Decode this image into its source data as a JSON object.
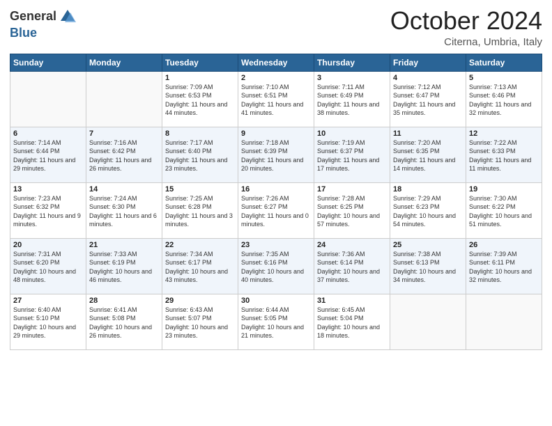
{
  "header": {
    "logo_general": "General",
    "logo_blue": "Blue",
    "month": "October 2024",
    "location": "Citerna, Umbria, Italy"
  },
  "weekdays": [
    "Sunday",
    "Monday",
    "Tuesday",
    "Wednesday",
    "Thursday",
    "Friday",
    "Saturday"
  ],
  "weeks": [
    [
      {
        "day": "",
        "sunrise": "",
        "sunset": "",
        "daylight": ""
      },
      {
        "day": "",
        "sunrise": "",
        "sunset": "",
        "daylight": ""
      },
      {
        "day": "1",
        "sunrise": "Sunrise: 7:09 AM",
        "sunset": "Sunset: 6:53 PM",
        "daylight": "Daylight: 11 hours and 44 minutes."
      },
      {
        "day": "2",
        "sunrise": "Sunrise: 7:10 AM",
        "sunset": "Sunset: 6:51 PM",
        "daylight": "Daylight: 11 hours and 41 minutes."
      },
      {
        "day": "3",
        "sunrise": "Sunrise: 7:11 AM",
        "sunset": "Sunset: 6:49 PM",
        "daylight": "Daylight: 11 hours and 38 minutes."
      },
      {
        "day": "4",
        "sunrise": "Sunrise: 7:12 AM",
        "sunset": "Sunset: 6:47 PM",
        "daylight": "Daylight: 11 hours and 35 minutes."
      },
      {
        "day": "5",
        "sunrise": "Sunrise: 7:13 AM",
        "sunset": "Sunset: 6:46 PM",
        "daylight": "Daylight: 11 hours and 32 minutes."
      }
    ],
    [
      {
        "day": "6",
        "sunrise": "Sunrise: 7:14 AM",
        "sunset": "Sunset: 6:44 PM",
        "daylight": "Daylight: 11 hours and 29 minutes."
      },
      {
        "day": "7",
        "sunrise": "Sunrise: 7:16 AM",
        "sunset": "Sunset: 6:42 PM",
        "daylight": "Daylight: 11 hours and 26 minutes."
      },
      {
        "day": "8",
        "sunrise": "Sunrise: 7:17 AM",
        "sunset": "Sunset: 6:40 PM",
        "daylight": "Daylight: 11 hours and 23 minutes."
      },
      {
        "day": "9",
        "sunrise": "Sunrise: 7:18 AM",
        "sunset": "Sunset: 6:39 PM",
        "daylight": "Daylight: 11 hours and 20 minutes."
      },
      {
        "day": "10",
        "sunrise": "Sunrise: 7:19 AM",
        "sunset": "Sunset: 6:37 PM",
        "daylight": "Daylight: 11 hours and 17 minutes."
      },
      {
        "day": "11",
        "sunrise": "Sunrise: 7:20 AM",
        "sunset": "Sunset: 6:35 PM",
        "daylight": "Daylight: 11 hours and 14 minutes."
      },
      {
        "day": "12",
        "sunrise": "Sunrise: 7:22 AM",
        "sunset": "Sunset: 6:33 PM",
        "daylight": "Daylight: 11 hours and 11 minutes."
      }
    ],
    [
      {
        "day": "13",
        "sunrise": "Sunrise: 7:23 AM",
        "sunset": "Sunset: 6:32 PM",
        "daylight": "Daylight: 11 hours and 9 minutes."
      },
      {
        "day": "14",
        "sunrise": "Sunrise: 7:24 AM",
        "sunset": "Sunset: 6:30 PM",
        "daylight": "Daylight: 11 hours and 6 minutes."
      },
      {
        "day": "15",
        "sunrise": "Sunrise: 7:25 AM",
        "sunset": "Sunset: 6:28 PM",
        "daylight": "Daylight: 11 hours and 3 minutes."
      },
      {
        "day": "16",
        "sunrise": "Sunrise: 7:26 AM",
        "sunset": "Sunset: 6:27 PM",
        "daylight": "Daylight: 11 hours and 0 minutes."
      },
      {
        "day": "17",
        "sunrise": "Sunrise: 7:28 AM",
        "sunset": "Sunset: 6:25 PM",
        "daylight": "Daylight: 10 hours and 57 minutes."
      },
      {
        "day": "18",
        "sunrise": "Sunrise: 7:29 AM",
        "sunset": "Sunset: 6:23 PM",
        "daylight": "Daylight: 10 hours and 54 minutes."
      },
      {
        "day": "19",
        "sunrise": "Sunrise: 7:30 AM",
        "sunset": "Sunset: 6:22 PM",
        "daylight": "Daylight: 10 hours and 51 minutes."
      }
    ],
    [
      {
        "day": "20",
        "sunrise": "Sunrise: 7:31 AM",
        "sunset": "Sunset: 6:20 PM",
        "daylight": "Daylight: 10 hours and 48 minutes."
      },
      {
        "day": "21",
        "sunrise": "Sunrise: 7:33 AM",
        "sunset": "Sunset: 6:19 PM",
        "daylight": "Daylight: 10 hours and 46 minutes."
      },
      {
        "day": "22",
        "sunrise": "Sunrise: 7:34 AM",
        "sunset": "Sunset: 6:17 PM",
        "daylight": "Daylight: 10 hours and 43 minutes."
      },
      {
        "day": "23",
        "sunrise": "Sunrise: 7:35 AM",
        "sunset": "Sunset: 6:16 PM",
        "daylight": "Daylight: 10 hours and 40 minutes."
      },
      {
        "day": "24",
        "sunrise": "Sunrise: 7:36 AM",
        "sunset": "Sunset: 6:14 PM",
        "daylight": "Daylight: 10 hours and 37 minutes."
      },
      {
        "day": "25",
        "sunrise": "Sunrise: 7:38 AM",
        "sunset": "Sunset: 6:13 PM",
        "daylight": "Daylight: 10 hours and 34 minutes."
      },
      {
        "day": "26",
        "sunrise": "Sunrise: 7:39 AM",
        "sunset": "Sunset: 6:11 PM",
        "daylight": "Daylight: 10 hours and 32 minutes."
      }
    ],
    [
      {
        "day": "27",
        "sunrise": "Sunrise: 6:40 AM",
        "sunset": "Sunset: 5:10 PM",
        "daylight": "Daylight: 10 hours and 29 minutes."
      },
      {
        "day": "28",
        "sunrise": "Sunrise: 6:41 AM",
        "sunset": "Sunset: 5:08 PM",
        "daylight": "Daylight: 10 hours and 26 minutes."
      },
      {
        "day": "29",
        "sunrise": "Sunrise: 6:43 AM",
        "sunset": "Sunset: 5:07 PM",
        "daylight": "Daylight: 10 hours and 23 minutes."
      },
      {
        "day": "30",
        "sunrise": "Sunrise: 6:44 AM",
        "sunset": "Sunset: 5:05 PM",
        "daylight": "Daylight: 10 hours and 21 minutes."
      },
      {
        "day": "31",
        "sunrise": "Sunrise: 6:45 AM",
        "sunset": "Sunset: 5:04 PM",
        "daylight": "Daylight: 10 hours and 18 minutes."
      },
      {
        "day": "",
        "sunrise": "",
        "sunset": "",
        "daylight": ""
      },
      {
        "day": "",
        "sunrise": "",
        "sunset": "",
        "daylight": ""
      }
    ]
  ]
}
